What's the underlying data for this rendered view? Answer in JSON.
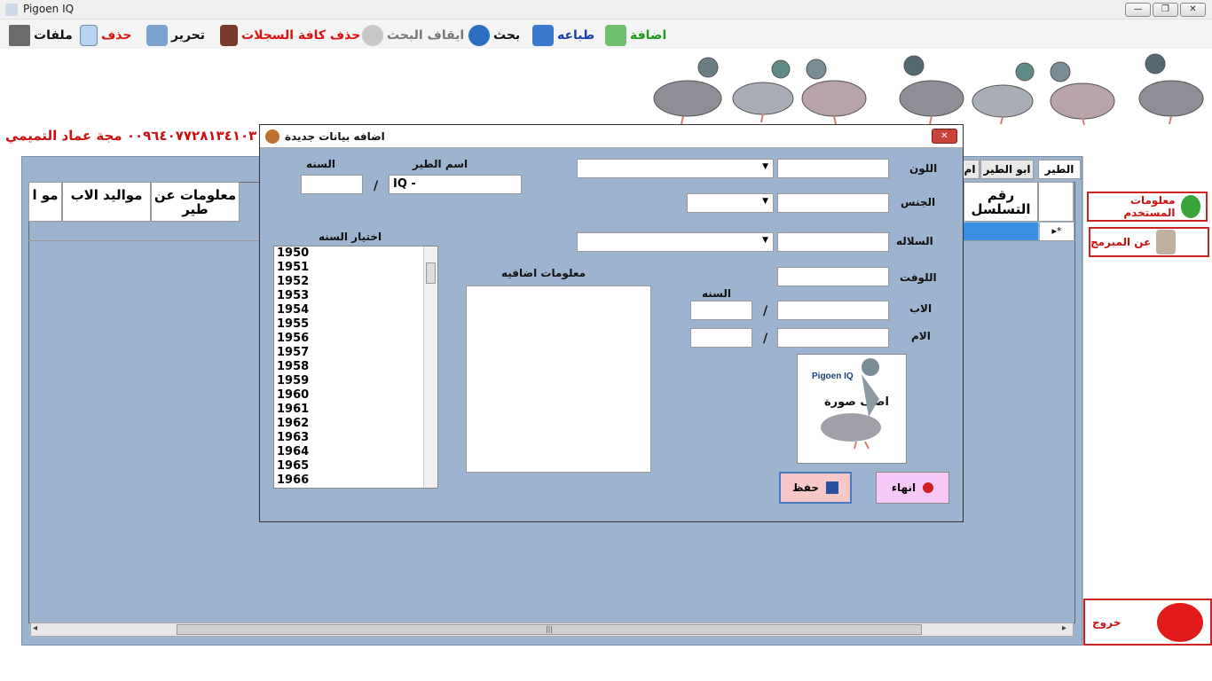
{
  "window": {
    "title": "Pigoen IQ",
    "min": "—",
    "max": "❐",
    "close": "✕"
  },
  "toolbar": {
    "files": "ملفات",
    "delete": "حذف",
    "edit": "تحرير",
    "delete_all": "حذف كافة السجلات",
    "stop_search": "ايقاف البحث",
    "search": "بحث",
    "print": "طباعه",
    "add": "اضافة"
  },
  "banner": {
    "contact": "٠٠٩٦٤٠٧٧٢٨١٣٤١٠٣ مجة عماد التميمي"
  },
  "main": {
    "tabs": [
      "الطير",
      "ابو الطير",
      "ام"
    ],
    "headers": {
      "serial": "رقم التسلسل",
      "info": "معلومات عن طير",
      "father_births": "مواليد الاب",
      "cut": "مو ا"
    },
    "row_marker": "▸*"
  },
  "side": {
    "user_info": "معلومات المستخدم",
    "about": "عن المبرمج",
    "exit": "خروج"
  },
  "scroll": {
    "left": "◂",
    "right": "▸",
    "grip": "|||"
  },
  "dialog": {
    "title": "اضافه بيانات جديدة",
    "close": "✕",
    "labels": {
      "color": "اللون",
      "sex": "الجنس",
      "strain": "السلاله",
      "loft": "اللوفت",
      "father": "الاب",
      "mother": "الام",
      "year_small": "السنه",
      "bird_name": "اسم الطير",
      "year_top": "السنه",
      "pick_year": "اختيار السنه",
      "extra_info": "معلومات اضافيه",
      "slash": "/"
    },
    "bird_name_value": "IQ -",
    "years": [
      "1950",
      "1951",
      "1952",
      "1953",
      "1954",
      "1955",
      "1956",
      "1957",
      "1958",
      "1959",
      "1960",
      "1961",
      "1962",
      "1963",
      "1964",
      "1965",
      "1966"
    ],
    "photo": {
      "brand": "Pigoen IQ",
      "add_photo": "اضف صورة"
    },
    "save": "حفظ",
    "finish": "انهاء"
  }
}
